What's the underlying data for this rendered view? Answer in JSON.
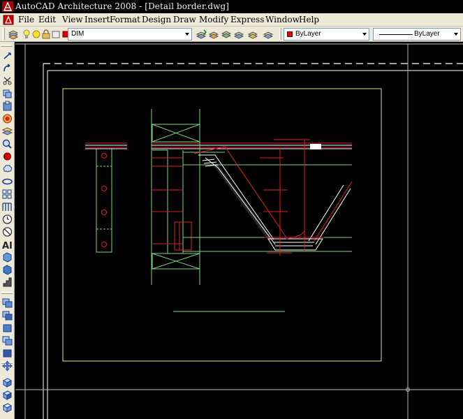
{
  "window": {
    "title": "AutoCAD Architecture 2008 - [Detail border.dwg]"
  },
  "menubar": {
    "items": [
      {
        "label": "File",
        "name": "menu-file"
      },
      {
        "label": "Edit",
        "name": "menu-edit"
      },
      {
        "label": "View",
        "name": "menu-view"
      },
      {
        "label": "Insert",
        "name": "menu-insert"
      },
      {
        "label": "Format",
        "name": "menu-format"
      },
      {
        "label": "Design",
        "name": "menu-design"
      },
      {
        "label": "Draw",
        "name": "menu-draw"
      },
      {
        "label": "Modify",
        "name": "menu-modify"
      },
      {
        "label": "Express",
        "name": "menu-express"
      },
      {
        "label": "Window",
        "name": "menu-window"
      },
      {
        "label": "Help",
        "name": "menu-help"
      }
    ]
  },
  "toolbar": {
    "layer_combo_value": "DIM",
    "color_combo_value": "ByLayer",
    "linetype_combo_value": "ByLayer"
  },
  "left_toolbar": {
    "icons": [
      "line-icon",
      "arc-icon",
      "scissors-icon",
      "copy-icon",
      "clipboard-icon",
      "target-icon",
      "layers-icon",
      "zoom-icon",
      "record-icon",
      "cloud-icon",
      "ellipse-icon",
      "grid-icon",
      "hatch-icon",
      "clock-icon",
      "no-entry-icon",
      "text-icon",
      "box-icon",
      "box-icon-2",
      "stairs-icon",
      "stack-icon",
      "stack-icon-2",
      "stack-icon-3",
      "stack-icon-4",
      "stack-icon-5",
      "pan-icon",
      "cube-icon",
      "cube-icon-2",
      "cube-icon-3"
    ]
  },
  "colors": {
    "canvas_bg": "#000000",
    "drawing_green": "#7fd47f",
    "drawing_red": "#e02020",
    "border_white": "#ffffff",
    "border_yellow": "#e6e68a",
    "chrome": "#ece9d8"
  }
}
